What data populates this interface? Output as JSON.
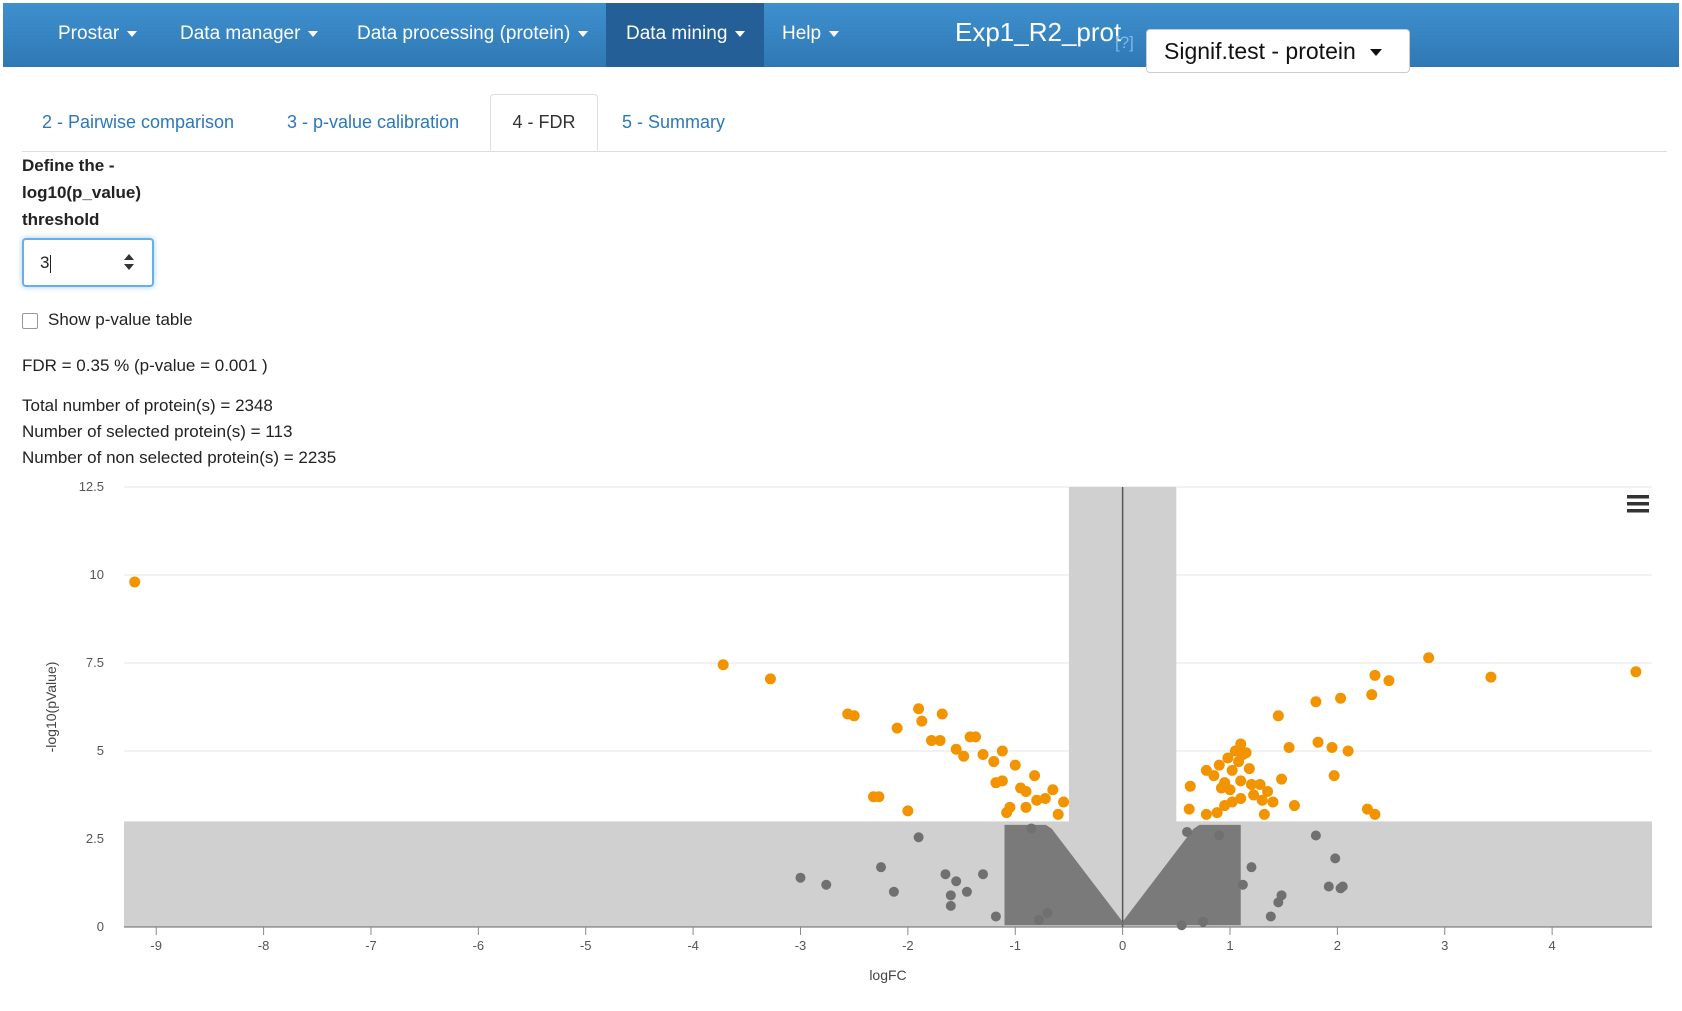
{
  "navbar": {
    "items": [
      {
        "label": "Prostar"
      },
      {
        "label": "Data manager"
      },
      {
        "label": "Data processing (protein)"
      },
      {
        "label": "Data mining"
      },
      {
        "label": "Help"
      }
    ],
    "dataset_name": "Exp1_R2_prot",
    "help_link": "[?]",
    "dataset_dropdown": "Signif.test - protein"
  },
  "tabs": [
    {
      "label": "2 - Pairwise comparison"
    },
    {
      "label": "3 - p-value calibration"
    },
    {
      "label": "4 - FDR"
    },
    {
      "label": "5 - Summary"
    }
  ],
  "threshold": {
    "label_line1": "Define the -",
    "label_line2": "log10(p_value)",
    "label_line3": "threshold",
    "value": "3"
  },
  "show_pvalue_table": {
    "label": "Show p-value table",
    "checked": false
  },
  "fdr_text": "FDR = 0.35 % (p-value = 0.001 )",
  "stats": {
    "total": "Total number of protein(s) = 2348",
    "selected": "Number of selected protein(s) = 113",
    "non_selected": "Number of non selected protein(s) = 2235"
  },
  "colors": {
    "selected": "#f29400",
    "non_selected": "#707070",
    "band": "#d0d0d0",
    "nav": "#3a87c3"
  },
  "chart_data": {
    "type": "scatter",
    "title": "",
    "xlabel": "logFC",
    "ylabel": "-log10(pValue)",
    "xlim": [
      -9.3,
      4.93
    ],
    "ylim": [
      0,
      12.5
    ],
    "xticks": [
      "-9",
      "-8",
      "-7",
      "-6",
      "-5",
      "-4",
      "-3",
      "-2",
      "-1",
      "0",
      "1",
      "2",
      "3",
      "4"
    ],
    "yticks": [
      "0",
      "2.5",
      "5",
      "7.5",
      "10",
      "12.5"
    ],
    "logfc_threshold": 0.5,
    "pvalue_threshold": 3,
    "menu_icon": "hamburger-icon",
    "series": [
      {
        "name": "selected",
        "points": [
          [
            -9.2,
            9.8
          ],
          [
            -3.72,
            7.45
          ],
          [
            -3.28,
            7.05
          ],
          [
            -2.56,
            6.05
          ],
          [
            -2.5,
            6.0
          ],
          [
            -1.9,
            6.2
          ],
          [
            -1.87,
            5.85
          ],
          [
            -1.68,
            6.05
          ],
          [
            -2.1,
            5.65
          ],
          [
            -1.78,
            5.3
          ],
          [
            -1.7,
            5.3
          ],
          [
            -1.42,
            5.4
          ],
          [
            -1.37,
            5.4
          ],
          [
            -1.55,
            5.05
          ],
          [
            -1.48,
            4.85
          ],
          [
            -1.3,
            4.9
          ],
          [
            -1.12,
            5.0
          ],
          [
            -1.2,
            4.7
          ],
          [
            -1.0,
            4.6
          ],
          [
            -0.82,
            4.3
          ],
          [
            -1.18,
            4.1
          ],
          [
            -1.12,
            4.15
          ],
          [
            -0.95,
            3.95
          ],
          [
            -0.9,
            3.85
          ],
          [
            -0.65,
            3.9
          ],
          [
            -0.8,
            3.6
          ],
          [
            -0.72,
            3.65
          ],
          [
            -0.55,
            3.55
          ],
          [
            -2.32,
            3.7
          ],
          [
            -2.27,
            3.7
          ],
          [
            -2.0,
            3.3
          ],
          [
            -1.05,
            3.4
          ],
          [
            -0.9,
            3.4
          ],
          [
            -0.6,
            3.2
          ],
          [
            -1.08,
            3.25
          ],
          [
            0.62,
            3.35
          ],
          [
            0.78,
            3.2
          ],
          [
            0.63,
            4.0
          ],
          [
            0.85,
            4.3
          ],
          [
            0.9,
            4.6
          ],
          [
            0.78,
            4.45
          ],
          [
            0.95,
            4.1
          ],
          [
            1.02,
            4.45
          ],
          [
            0.98,
            4.8
          ],
          [
            1.05,
            5.0
          ],
          [
            1.08,
            4.7
          ],
          [
            1.12,
            4.9
          ],
          [
            1.18,
            4.5
          ],
          [
            1.0,
            3.9
          ],
          [
            0.92,
            3.95
          ],
          [
            1.1,
            4.15
          ],
          [
            1.2,
            4.05
          ],
          [
            1.28,
            4.05
          ],
          [
            1.35,
            3.85
          ],
          [
            1.48,
            4.2
          ],
          [
            1.3,
            3.6
          ],
          [
            1.4,
            3.55
          ],
          [
            1.6,
            3.45
          ],
          [
            1.1,
            3.65
          ],
          [
            1.02,
            3.55
          ],
          [
            0.88,
            3.25
          ],
          [
            0.95,
            3.45
          ],
          [
            1.22,
            3.75
          ],
          [
            1.45,
            6.0
          ],
          [
            1.55,
            5.1
          ],
          [
            1.8,
            6.4
          ],
          [
            1.95,
            5.1
          ],
          [
            2.03,
            6.5
          ],
          [
            2.1,
            5.0
          ],
          [
            1.97,
            4.3
          ],
          [
            2.32,
            6.6
          ],
          [
            2.35,
            7.15
          ],
          [
            2.48,
            7.0
          ],
          [
            2.85,
            7.65
          ],
          [
            3.43,
            7.1
          ],
          [
            4.78,
            7.25
          ],
          [
            2.28,
            3.35
          ],
          [
            2.35,
            3.2
          ],
          [
            1.82,
            5.25
          ],
          [
            1.32,
            3.2
          ],
          [
            1.1,
            5.2
          ],
          [
            1.15,
            4.95
          ]
        ]
      },
      {
        "name": "non_selected",
        "points": [
          [
            -3.0,
            1.4
          ],
          [
            -2.76,
            1.2
          ],
          [
            -2.25,
            1.7
          ],
          [
            -2.13,
            1.0
          ],
          [
            -1.9,
            2.55
          ],
          [
            -1.65,
            1.5
          ],
          [
            -1.6,
            0.9
          ],
          [
            -1.55,
            1.3
          ],
          [
            -1.45,
            1.0
          ],
          [
            -1.3,
            1.5
          ],
          [
            -1.18,
            0.3
          ],
          [
            -0.78,
            0.2
          ],
          [
            -0.7,
            0.4
          ],
          [
            -1.6,
            0.6
          ],
          [
            -0.85,
            2.8
          ],
          [
            0.6,
            2.7
          ],
          [
            0.9,
            2.6
          ],
          [
            1.2,
            1.7
          ],
          [
            1.12,
            1.2
          ],
          [
            1.45,
            0.7
          ],
          [
            1.38,
            0.3
          ],
          [
            1.48,
            0.9
          ],
          [
            1.8,
            2.6
          ],
          [
            1.98,
            1.95
          ],
          [
            1.92,
            1.15
          ],
          [
            2.05,
            1.15
          ],
          [
            2.03,
            1.1
          ],
          [
            0.75,
            0.15
          ],
          [
            0.55,
            0.05
          ]
        ]
      }
    ]
  }
}
